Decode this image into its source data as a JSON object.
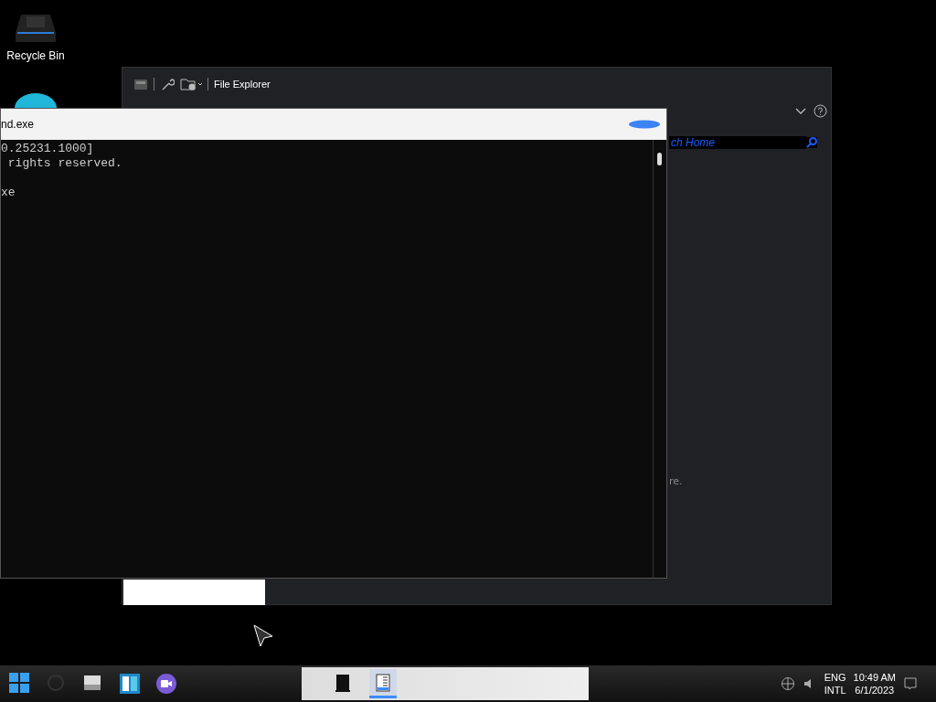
{
  "desktop_icons": [
    {
      "label": "Recycle Bin",
      "kind": "bin"
    },
    {
      "kind": "edge"
    }
  ],
  "explorer": {
    "title": "File Explorer",
    "search": {
      "placeholder": "ch Home"
    },
    "status_text": "re."
  },
  "console": {
    "title": "nd.exe",
    "output": "0.25231.1000]\n rights reserved.\n\nxe"
  },
  "taskbar": {
    "pinned": [
      {
        "kind": "start"
      },
      {
        "kind": "search"
      },
      {
        "kind": "taskview"
      },
      {
        "kind": "widgets"
      },
      {
        "kind": "chat"
      }
    ],
    "apps": [
      {
        "kind": "console",
        "selected": false
      },
      {
        "kind": "explorer",
        "selected": true
      }
    ],
    "tray": {
      "language": "ENG",
      "layout": "INTL",
      "time": "10:49 AM",
      "date": "6/1/2023"
    }
  }
}
